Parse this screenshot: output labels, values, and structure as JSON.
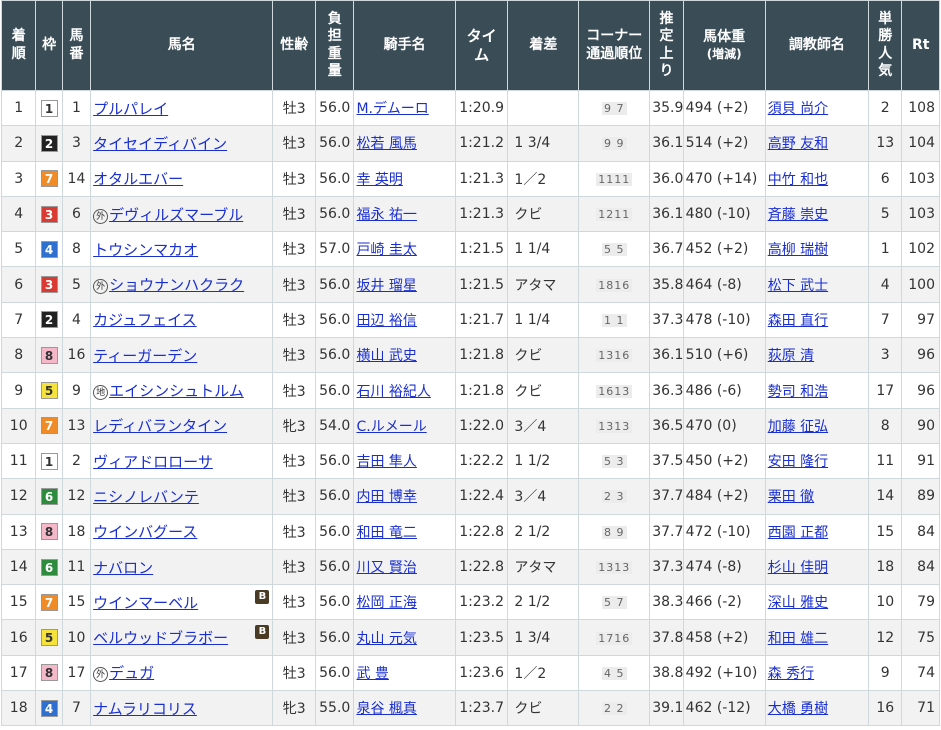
{
  "colors": {
    "header_bg": "#3a4d57",
    "link": "#1a2fcf",
    "border": "#cfd8dc",
    "blinker": "#4a3b25"
  },
  "waku_colors": {
    "1": {
      "bg": "#ffffff",
      "fg": "#333333"
    },
    "2": {
      "bg": "#222222",
      "fg": "#ffffff"
    },
    "3": {
      "bg": "#d93a32",
      "fg": "#ffffff"
    },
    "4": {
      "bg": "#2f6fcf",
      "fg": "#ffffff"
    },
    "5": {
      "bg": "#f5e23a",
      "fg": "#333333"
    },
    "6": {
      "bg": "#2e8b3d",
      "fg": "#ffffff"
    },
    "7": {
      "bg": "#f08c28",
      "fg": "#ffffff"
    },
    "8": {
      "bg": "#f4b8c8",
      "fg": "#333333"
    }
  },
  "headers": {
    "rank": "着順",
    "waku": "枠",
    "umaban": "馬番",
    "horse": "馬名",
    "sex_age": "性齢",
    "weight": "負担重量",
    "jockey": "騎手名",
    "time": "タイム",
    "margin": "着差",
    "corner": "コーナー通過順位",
    "last3f": "推定上り",
    "body_weight": "馬体重",
    "body_weight_sub": "(増減)",
    "trainer": "調教師名",
    "odds_pop": "単勝人気",
    "rt": "Rt"
  },
  "rows": [
    {
      "rank": "1",
      "waku": "1",
      "umaban": "1",
      "mark": "",
      "horse": "プルパレイ",
      "blinker": "",
      "sex_age": "牡3",
      "weight": "56.0",
      "jockey": "M.デムーロ",
      "time": "1:20.9",
      "margin": "",
      "corner": "9 7",
      "last3f": "35.9",
      "body_weight": "494 (+2)",
      "trainer": "須貝 尚介",
      "pop": "2",
      "rt": "108"
    },
    {
      "rank": "2",
      "waku": "2",
      "umaban": "3",
      "mark": "",
      "horse": "タイセイディバイン",
      "blinker": "",
      "sex_age": "牡3",
      "weight": "56.0",
      "jockey": "松若 風馬",
      "time": "1:21.2",
      "margin": "1 3/4",
      "corner": "9 9",
      "last3f": "36.1",
      "body_weight": "514 (+2)",
      "trainer": "高野 友和",
      "pop": "13",
      "rt": "104"
    },
    {
      "rank": "3",
      "waku": "7",
      "umaban": "14",
      "mark": "",
      "horse": "オタルエバー",
      "blinker": "",
      "sex_age": "牡3",
      "weight": "56.0",
      "jockey": "幸 英明",
      "time": "1:21.3",
      "margin": "1／2",
      "corner": "1111",
      "last3f": "36.0",
      "body_weight": "470 (+14)",
      "trainer": "中竹 和也",
      "pop": "6",
      "rt": "103"
    },
    {
      "rank": "4",
      "waku": "3",
      "umaban": "6",
      "mark": "外",
      "horse": "デヴィルズマーブル",
      "blinker": "",
      "sex_age": "牡3",
      "weight": "56.0",
      "jockey": "福永 祐一",
      "time": "1:21.3",
      "margin": "クビ",
      "corner": "1211",
      "last3f": "36.1",
      "body_weight": "480 (-10)",
      "trainer": "斉藤 崇史",
      "pop": "5",
      "rt": "103"
    },
    {
      "rank": "5",
      "waku": "4",
      "umaban": "8",
      "mark": "",
      "horse": "トウシンマカオ",
      "blinker": "",
      "sex_age": "牡3",
      "weight": "57.0",
      "jockey": "戸崎 圭太",
      "time": "1:21.5",
      "margin": "1 1/4",
      "corner": "5 5",
      "last3f": "36.7",
      "body_weight": "452 (+2)",
      "trainer": "高柳 瑞樹",
      "pop": "1",
      "rt": "102"
    },
    {
      "rank": "6",
      "waku": "3",
      "umaban": "5",
      "mark": "外",
      "horse": "ショウナンハクラク",
      "blinker": "",
      "sex_age": "牡3",
      "weight": "56.0",
      "jockey": "坂井 瑠星",
      "time": "1:21.5",
      "margin": "アタマ",
      "corner": "1816",
      "last3f": "35.8",
      "body_weight": "464 (-8)",
      "trainer": "松下 武士",
      "pop": "4",
      "rt": "100"
    },
    {
      "rank": "7",
      "waku": "2",
      "umaban": "4",
      "mark": "",
      "horse": "カジュフェイス",
      "blinker": "",
      "sex_age": "牡3",
      "weight": "56.0",
      "jockey": "田辺 裕信",
      "time": "1:21.7",
      "margin": "1 1/4",
      "corner": "1 1",
      "last3f": "37.3",
      "body_weight": "478 (-10)",
      "trainer": "森田 直行",
      "pop": "7",
      "rt": "97"
    },
    {
      "rank": "8",
      "waku": "8",
      "umaban": "16",
      "mark": "",
      "horse": "ティーガーデン",
      "blinker": "",
      "sex_age": "牡3",
      "weight": "56.0",
      "jockey": "横山 武史",
      "time": "1:21.8",
      "margin": "クビ",
      "corner": "1316",
      "last3f": "36.1",
      "body_weight": "510 (+6)",
      "trainer": "荻原 清",
      "pop": "3",
      "rt": "96"
    },
    {
      "rank": "9",
      "waku": "5",
      "umaban": "9",
      "mark": "地",
      "horse": "エイシンシュトルム",
      "blinker": "",
      "sex_age": "牡3",
      "weight": "56.0",
      "jockey": "石川 裕紀人",
      "time": "1:21.8",
      "margin": "クビ",
      "corner": "1613",
      "last3f": "36.3",
      "body_weight": "486 (-6)",
      "trainer": "勢司 和浩",
      "pop": "17",
      "rt": "96"
    },
    {
      "rank": "10",
      "waku": "7",
      "umaban": "13",
      "mark": "",
      "horse": "レディバランタイン",
      "blinker": "",
      "sex_age": "牝3",
      "weight": "54.0",
      "jockey": "C.ルメール",
      "time": "1:22.0",
      "margin": "3／4",
      "corner": "1313",
      "last3f": "36.5",
      "body_weight": "470 (0)",
      "trainer": "加藤 征弘",
      "pop": "8",
      "rt": "90"
    },
    {
      "rank": "11",
      "waku": "1",
      "umaban": "2",
      "mark": "",
      "horse": "ヴィアドロローサ",
      "blinker": "",
      "sex_age": "牡3",
      "weight": "56.0",
      "jockey": "吉田 隼人",
      "time": "1:22.2",
      "margin": "1 1/2",
      "corner": "5 3",
      "last3f": "37.5",
      "body_weight": "450 (+2)",
      "trainer": "安田 隆行",
      "pop": "11",
      "rt": "91"
    },
    {
      "rank": "12",
      "waku": "6",
      "umaban": "12",
      "mark": "",
      "horse": "ニシノレバンテ",
      "blinker": "",
      "sex_age": "牡3",
      "weight": "56.0",
      "jockey": "内田 博幸",
      "time": "1:22.4",
      "margin": "3／4",
      "corner": "2 3",
      "last3f": "37.7",
      "body_weight": "484 (+2)",
      "trainer": "栗田 徹",
      "pop": "14",
      "rt": "89"
    },
    {
      "rank": "13",
      "waku": "8",
      "umaban": "18",
      "mark": "",
      "horse": "ウインバグース",
      "blinker": "",
      "sex_age": "牡3",
      "weight": "56.0",
      "jockey": "和田 竜二",
      "time": "1:22.8",
      "margin": "2 1/2",
      "corner": "8 9",
      "last3f": "37.7",
      "body_weight": "472 (-10)",
      "trainer": "西園 正都",
      "pop": "15",
      "rt": "84"
    },
    {
      "rank": "14",
      "waku": "6",
      "umaban": "11",
      "mark": "",
      "horse": "ナバロン",
      "blinker": "",
      "sex_age": "牡3",
      "weight": "56.0",
      "jockey": "川又 賢治",
      "time": "1:22.8",
      "margin": "アタマ",
      "corner": "1313",
      "last3f": "37.3",
      "body_weight": "474 (-8)",
      "trainer": "杉山 佳明",
      "pop": "18",
      "rt": "84"
    },
    {
      "rank": "15",
      "waku": "7",
      "umaban": "15",
      "mark": "",
      "horse": "ウインマーベル",
      "blinker": "B",
      "sex_age": "牡3",
      "weight": "56.0",
      "jockey": "松岡 正海",
      "time": "1:23.2",
      "margin": "2 1/2",
      "corner": "5 7",
      "last3f": "38.3",
      "body_weight": "466 (-2)",
      "trainer": "深山 雅史",
      "pop": "10",
      "rt": "79"
    },
    {
      "rank": "16",
      "waku": "5",
      "umaban": "10",
      "mark": "",
      "horse": "ベルウッドブラボー",
      "blinker": "B",
      "sex_age": "牡3",
      "weight": "56.0",
      "jockey": "丸山 元気",
      "time": "1:23.5",
      "margin": "1 3/4",
      "corner": "1716",
      "last3f": "37.8",
      "body_weight": "458 (+2)",
      "trainer": "和田 雄二",
      "pop": "12",
      "rt": "75"
    },
    {
      "rank": "17",
      "waku": "8",
      "umaban": "17",
      "mark": "外",
      "horse": "デュガ",
      "blinker": "",
      "sex_age": "牡3",
      "weight": "56.0",
      "jockey": "武 豊",
      "time": "1:23.6",
      "margin": "1／2",
      "corner": "4 5",
      "last3f": "38.8",
      "body_weight": "492 (+10)",
      "trainer": "森 秀行",
      "pop": "9",
      "rt": "74"
    },
    {
      "rank": "18",
      "waku": "4",
      "umaban": "7",
      "mark": "",
      "horse": "ナムラリコリス",
      "blinker": "",
      "sex_age": "牝3",
      "weight": "55.0",
      "jockey": "泉谷 楓真",
      "time": "1:23.7",
      "margin": "クビ",
      "corner": "2 2",
      "last3f": "39.1",
      "body_weight": "462 (-12)",
      "trainer": "大橋 勇樹",
      "pop": "16",
      "rt": "71"
    }
  ]
}
